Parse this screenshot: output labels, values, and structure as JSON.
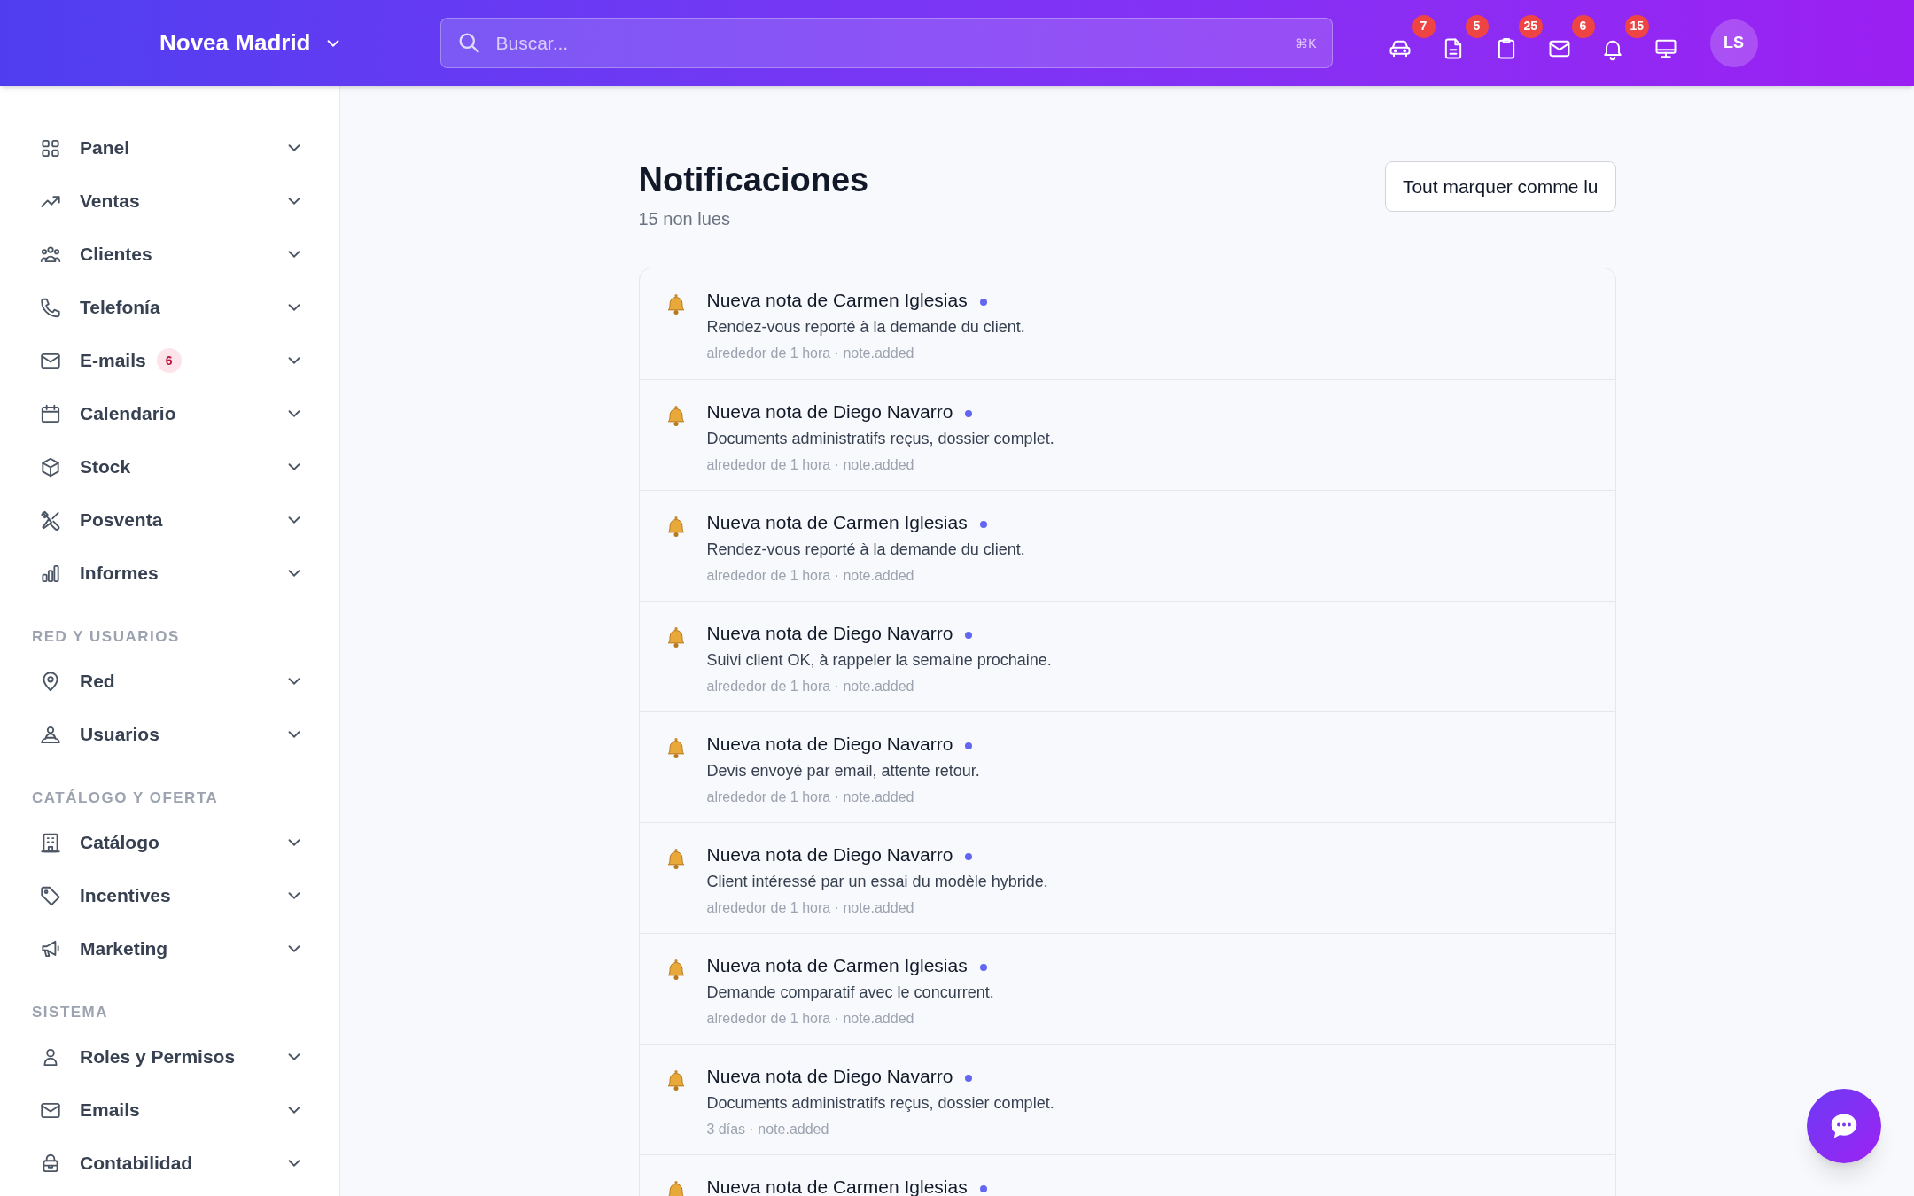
{
  "header": {
    "workspace": "Novea Madrid",
    "search": {
      "placeholder": "Buscar...",
      "shortcut": "⌘K"
    },
    "actions": [
      {
        "kind": "car",
        "badge": "7"
      },
      {
        "kind": "document",
        "badge": "5"
      },
      {
        "kind": "clipboard",
        "badge": "25"
      },
      {
        "kind": "mail",
        "badge": "6"
      },
      {
        "kind": "bell",
        "badge": "15"
      },
      {
        "kind": "monitor"
      }
    ],
    "avatar": "LS"
  },
  "sidebar": {
    "sections": [
      {
        "items": [
          {
            "label": "Panel"
          },
          {
            "label": "Ventas"
          },
          {
            "label": "Clientes"
          },
          {
            "label": "Telefonía"
          },
          {
            "label": "E-mails",
            "badge": "6"
          },
          {
            "label": "Calendario"
          },
          {
            "label": "Stock"
          },
          {
            "label": "Posventa"
          },
          {
            "label": "Informes"
          }
        ]
      },
      {
        "title": "RED Y USUARIOS",
        "items": [
          {
            "label": "Red"
          },
          {
            "label": "Usuarios"
          }
        ]
      },
      {
        "title": "CATÁLOGO Y OFERTA",
        "items": [
          {
            "label": "Catálogo"
          },
          {
            "label": "Incentives"
          },
          {
            "label": "Marketing"
          }
        ]
      },
      {
        "title": "SISTEMA",
        "items": [
          {
            "label": "Roles y Permisos"
          },
          {
            "label": "Emails"
          },
          {
            "label": "Contabilidad"
          }
        ]
      }
    ]
  },
  "page": {
    "title": "Notificaciones",
    "subtitle": "15 non lues",
    "mark_all_button": "Tout marquer comme lu"
  },
  "notifications": [
    {
      "title": "Nueva nota de Carmen Iglesias",
      "unread": true,
      "body": "Rendez-vous reporté à la demande du client.",
      "meta": "alrededor de 1 hora · note.added"
    },
    {
      "title": "Nueva nota de Diego Navarro",
      "unread": true,
      "body": "Documents administratifs reçus, dossier complet.",
      "meta": "alrededor de 1 hora · note.added"
    },
    {
      "title": "Nueva nota de Carmen Iglesias",
      "unread": true,
      "body": "Rendez-vous reporté à la demande du client.",
      "meta": "alrededor de 1 hora · note.added"
    },
    {
      "title": "Nueva nota de Diego Navarro",
      "unread": true,
      "body": "Suivi client OK, à rappeler la semaine prochaine.",
      "meta": "alrededor de 1 hora · note.added"
    },
    {
      "title": "Nueva nota de Diego Navarro",
      "unread": true,
      "body": "Devis envoyé par email, attente retour.",
      "meta": "alrededor de 1 hora · note.added"
    },
    {
      "title": "Nueva nota de Diego Navarro",
      "unread": true,
      "body": "Client intéressé par un essai du modèle hybride.",
      "meta": "alrededor de 1 hora · note.added"
    },
    {
      "title": "Nueva nota de Carmen Iglesias",
      "unread": true,
      "body": "Demande comparatif avec le concurrent.",
      "meta": "alrededor de 1 hora · note.added"
    },
    {
      "title": "Nueva nota de Diego Navarro",
      "unread": true,
      "body": "Documents administratifs reçus, dossier complet.",
      "meta": "3 días · note.added"
    },
    {
      "title": "Nueva nota de Carmen Iglesias",
      "unread": true
    }
  ]
}
